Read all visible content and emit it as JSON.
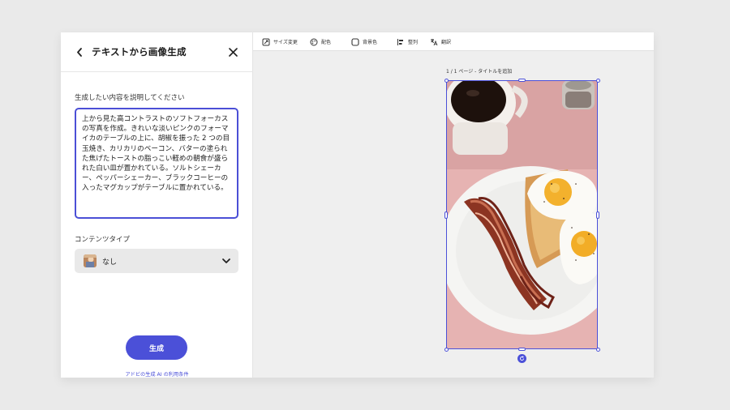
{
  "panel": {
    "title": "テキストから画像生成",
    "prompt_label": "生成したい内容を説明してください",
    "prompt_value": "上から見た高コントラストのソフトフォーカスの写真を作成。きれいな淡いピンクのフォーマイカのテーブルの上に、胡椒を振った 2 つの目玉焼き、カリカリのベーコン、バターの塗られた焦げたトーストの脂っこい軽めの朝食が盛られた白い皿が置かれている。ソルトシェーカー、ペッパーシェーカー、ブラックコーヒーの入ったマグカップがテーブルに置かれている。",
    "content_type_label": "コンテンツタイプ",
    "content_type_value": "なし",
    "generate_label": "生成",
    "terms_link": "アドビの生成 AI の利用条件"
  },
  "toolbar": {
    "items": [
      {
        "label": "サイズ変更",
        "icon": "resize-icon"
      },
      {
        "label": "配色",
        "icon": "palette-icon"
      },
      {
        "label": "背景色",
        "icon": "background-color-icon"
      },
      {
        "label": "整列",
        "icon": "align-icon"
      },
      {
        "label": "翻訳",
        "icon": "translate-icon"
      }
    ]
  },
  "canvas": {
    "page_label": "1 / 1 ページ - タイトルを追加"
  },
  "colors": {
    "accent": "#4b50d8",
    "table_pink": "#e9b8b6",
    "panel_bg": "#ffffff",
    "canvas_bg": "#efefef"
  }
}
